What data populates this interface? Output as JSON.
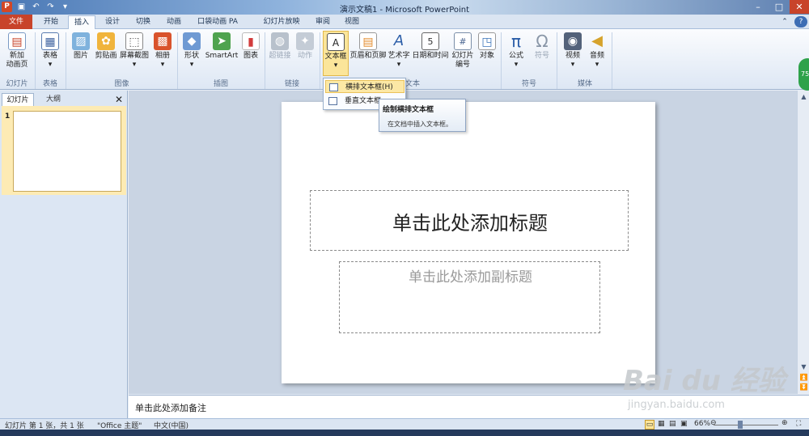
{
  "window": {
    "title": "演示文稿1 - Microsoft PowerPoint",
    "app_icon": "P"
  },
  "tabs": {
    "file": "文件",
    "home": "开始",
    "insert": "插入",
    "design": "设计",
    "transitions": "切换",
    "animations": "动画",
    "pocket": "口袋动画 PA",
    "slideshow": "幻灯片放映",
    "review": "审阅",
    "view": "视图"
  },
  "ribbon": {
    "new_slide": "新加\n动画页",
    "table": "表格",
    "picture": "图片",
    "clipart": "剪贴画",
    "screenshot": "屏幕截图",
    "album": "相册",
    "shapes": "形状",
    "smartart": "SmartArt",
    "chart": "图表",
    "hyperlink": "超链接",
    "action": "动作",
    "textbox": "文本框",
    "header_footer": "页眉和页脚",
    "wordart": "艺术字",
    "datetime": "日期和时间",
    "slide_number": "幻灯片\n编号",
    "object": "对象",
    "equation": "公式",
    "symbol": "符号",
    "video": "视频",
    "audio": "音频",
    "groups": {
      "slides": "幻灯片",
      "tables": "表格",
      "images": "图像",
      "illustrations": "插图",
      "links": "链接",
      "text": "文本",
      "symbols": "符号",
      "media": "媒体"
    }
  },
  "dropdown": {
    "horizontal": "横排文本框(H)",
    "vertical": "垂直文本框"
  },
  "tooltip": {
    "title": "绘制横排文本框",
    "desc": "在文档中插入文本框。"
  },
  "sidebar": {
    "tab_slides": "幻灯片",
    "tab_outline": "大纲",
    "slide_index": "1"
  },
  "slide": {
    "title_placeholder": "单击此处添加标题",
    "subtitle_placeholder": "单击此处添加副标题"
  },
  "notes": {
    "placeholder": "单击此处添加备注"
  },
  "status": {
    "slide_info": "幻灯片 第 1 张，共 1 张",
    "theme": "\"Office 主题\"",
    "language": "中文(中国)",
    "zoom": "66%"
  },
  "badge": {
    "text": "75"
  },
  "watermark": {
    "logo": "Bai du 经验",
    "url": "jingyan.baidu.com"
  }
}
